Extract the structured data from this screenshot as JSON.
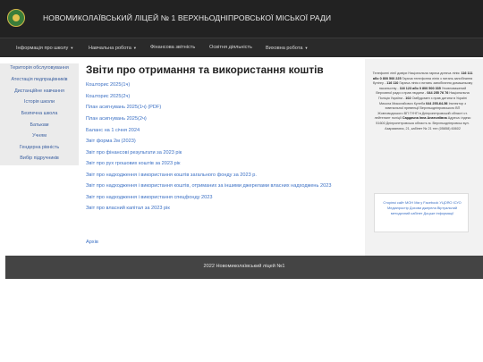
{
  "header": {
    "title": "НОВОМИКОЛАЇВСЬКИЙ ЛІЦЕЙ № 1 ВЕРХНЬОДНІПРОВСЬКОЇ МІСЬКОЇ РАДИ",
    "logo_icon": "school-emblem-icon"
  },
  "nav": [
    {
      "label": "Інформація про школу",
      "dropdown": true
    },
    {
      "label": "Навчальна робота",
      "dropdown": true
    },
    {
      "label": "Фінансова звітність",
      "dropdown": false
    },
    {
      "label": "Освітня діяльність",
      "dropdown": false
    },
    {
      "label": "Виховна робота",
      "dropdown": true
    }
  ],
  "sidebar": {
    "items": [
      "Територія обслуговування",
      "Атестація педпрацівників",
      "Дистанційне навчання",
      "Історія школи",
      "Безпечна школа",
      "Батькам",
      "Учням",
      "Гендерна рівність",
      "Вибір підручників"
    ]
  },
  "main": {
    "title": "Звіти про отримання та використання коштів",
    "links": [
      "Кошторис 2025(1ч)",
      "Кошторис 2025(2ч)",
      "План асигнувань 2025(1ч) (PDF)",
      "План асигнувань 2025(2ч)",
      "Баланс на 1 січня 2024",
      "Звіт форма 2м (2023)",
      "Звіт про фінансові результати за 2023 рік",
      "Звіт про рух грошових коштів за 2023 рік",
      "Звіт про надходження і використання коштів загального фонду за 2023 р.",
      "Звіт про надходження і використання коштів, отриманих за іншими джерелами власних надходжень 2023",
      "Звіт про надходження і використання спецфонду 2023",
      "Звіт про власний капітал за 2023 рік"
    ],
    "archive": "Архів"
  },
  "right": {
    "info": {
      "p1": "Телефонні лінії довіри Національна гаряча дитяча лінія:",
      "p1b": "116 111 або 0 800 500 225",
      "p2": "Гаряча телефонна лінія з питань запобігання булінгу -",
      "p2b": "116 110",
      "p3": "Гаряча лінія з питань запобігання домашньому насильству -",
      "p3b": "116 123 або 0 800 500 335",
      "p4": "Уповноважений Верховної ради з прав людини -",
      "p4b": "044 255 76 76",
      "p5": "Національна Поліція України -",
      "p5b": "102",
      "p6": "Омбудсмен з прав дитини в Україні Микола Миколайович Кулеба",
      "p6b": "044 255-64-56",
      "p7": "Інспектор з ювенальної превенції Верхньодніпровського ВП Жовтоводського ВП ГУНП в Дніпропетровській області ст. лейтенант поліції",
      "p7b": "Сардачна Інна Анатоліївна",
      "p8": "Адреса: індекс 51600 Дніпропетровська область м. Верхньодніпровськ вул. Азарманина, 21, кабінет № 21 тел (05658) 60602"
    },
    "banner": "Сторінкі сайт МОН Мм у Facebook УЦОЯО ІСУО Медіапростір Дохови джерела Віртуальний методичний кабінет Доцьке інформації"
  },
  "footer": {
    "text": "2022 Новомиколаївський ліцей №1"
  }
}
